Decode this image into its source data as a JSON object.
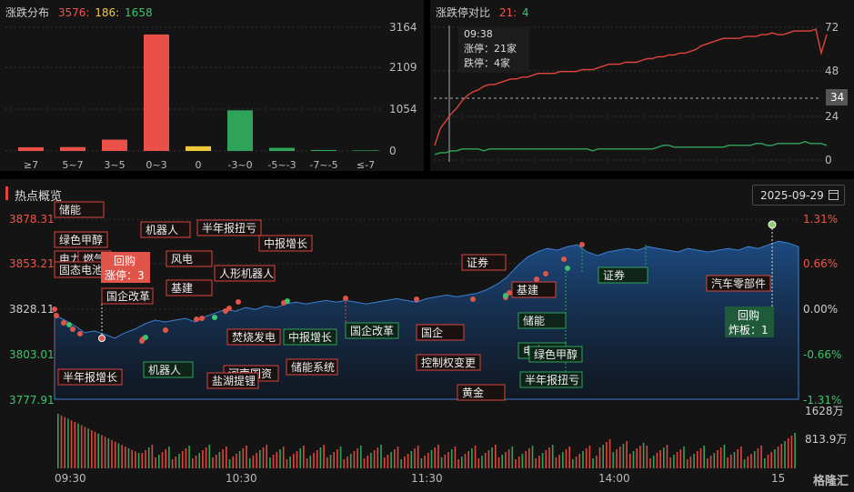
{
  "dist": {
    "title": "涨跌分布",
    "up": "3576:",
    "flat": "186:",
    "down": "1658",
    "y_ticks": [
      "3164",
      "2109",
      "1054",
      "0"
    ],
    "chart_data": {
      "type": "bar",
      "categories": [
        "≥7",
        "5~7",
        "3~5",
        "0~3",
        "0",
        "-3~0",
        "-5~-3",
        "-7~-5",
        "≤-7"
      ],
      "values": [
        95,
        100,
        290,
        2980,
        120,
        1040,
        80,
        25,
        15
      ],
      "colors": [
        "#e95148",
        "#e95148",
        "#e95148",
        "#e95148",
        "#f0c93a",
        "#2fa35a",
        "#2fa35a",
        "#2fa35a",
        "#2fa35a"
      ],
      "ylim": [
        0,
        3164
      ]
    }
  },
  "ratio": {
    "title": "涨跌停对比",
    "up": "21:",
    "down": "4",
    "y_ticks": [
      "72",
      "48",
      "24",
      "0"
    ],
    "current_label": "34",
    "tooltip": {
      "time": "09:38",
      "up": "涨停：21家",
      "down": "跌停：4家"
    },
    "chart_data": {
      "type": "line",
      "ylim": [
        0,
        72
      ],
      "series": [
        {
          "color": "#e0443c",
          "values": [
            8,
            17,
            21,
            25,
            28,
            32,
            35,
            37,
            38,
            40,
            41,
            41,
            42,
            43,
            44,
            44,
            45,
            45,
            46,
            47,
            47,
            47,
            47,
            48,
            48,
            48,
            48,
            49,
            49,
            49,
            50,
            51,
            52,
            52,
            52,
            53,
            53,
            53,
            54,
            55,
            55,
            56,
            56,
            57,
            57,
            58,
            58,
            59,
            60,
            62,
            63,
            64,
            65,
            66,
            66,
            66,
            66,
            67,
            67,
            67,
            68,
            68,
            69,
            68,
            68,
            69,
            70,
            70,
            70,
            70,
            71,
            58,
            68
          ]
        },
        {
          "color": "#2fa35a",
          "values": [
            3,
            4,
            4,
            5,
            5,
            6,
            6,
            6,
            6,
            5,
            6,
            6,
            6,
            6,
            6,
            6,
            6,
            6,
            6,
            6,
            6,
            6,
            6,
            6,
            6,
            6,
            6,
            6,
            6,
            5,
            6,
            6,
            6,
            6,
            6,
            6,
            6,
            6,
            6,
            6,
            6,
            7,
            8,
            8,
            7,
            7,
            7,
            7,
            7,
            7,
            7,
            7,
            7,
            7,
            8,
            8,
            8,
            8,
            8,
            9,
            9,
            8,
            8,
            9,
            9,
            9,
            9,
            9,
            10,
            9,
            9,
            9,
            8
          ]
        }
      ]
    }
  },
  "hot": {
    "title": "热点概览",
    "date": "2025-09-29",
    "y_left": [
      "3878.31",
      "3853.21",
      "3828.11",
      "3803.01",
      "3777.91"
    ],
    "y_right": [
      "1.31%",
      "0.66%",
      "0.00%",
      "-0.66%",
      "-1.31%"
    ],
    "vol_labels": [
      "1628万",
      "813.9万"
    ],
    "x_ticks": [
      "09:30",
      "10:30",
      "11:30",
      "14:00",
      "15"
    ],
    "chart_data": {
      "type": "area",
      "ylim": [
        3777.91,
        3878.31
      ],
      "values": [
        3825,
        3822,
        3819,
        3815,
        3816,
        3814,
        3812,
        3815,
        3817,
        3820,
        3822,
        3821,
        3822,
        3823,
        3821,
        3824,
        3826,
        3828,
        3827,
        3829,
        3828,
        3830,
        3829,
        3831,
        3832,
        3831,
        3832,
        3833,
        3832,
        3833,
        3832,
        3831,
        3832,
        3833,
        3834,
        3833,
        3832,
        3834,
        3835,
        3836,
        3835,
        3836,
        3837,
        3839,
        3842,
        3846,
        3852,
        3857,
        3860,
        3862,
        3861,
        3863,
        3864,
        3860,
        3858,
        3860,
        3861,
        3862,
        3861,
        3863,
        3862,
        3861,
        3860,
        3862,
        3861,
        3860,
        3861,
        3862,
        3861,
        3863,
        3862,
        3864,
        3866,
        3865,
        3863
      ]
    },
    "tags": [
      {
        "t": "储能",
        "k": "r"
      },
      {
        "t": "绿色甲醇",
        "k": "r"
      },
      {
        "t": "电力",
        "k": "r"
      },
      {
        "t": "燃气",
        "k": "r"
      },
      {
        "t": "固态电池",
        "k": "r"
      },
      {
        "t": "国企改革",
        "k": "r"
      },
      {
        "t": "半年报增长",
        "k": "r"
      },
      {
        "t": "机器人",
        "k": "r"
      },
      {
        "t": "风电",
        "k": "r"
      },
      {
        "t": "基建",
        "k": "r"
      },
      {
        "t": "机器人",
        "k": "g"
      },
      {
        "t": "半年报扭亏",
        "k": "r"
      },
      {
        "t": "中报增长",
        "k": "r"
      },
      {
        "t": "人形机器人",
        "k": "r"
      },
      {
        "t": "焚烧发电",
        "k": "r"
      },
      {
        "t": "河南国资",
        "k": "r"
      },
      {
        "t": "盐湖提锂",
        "k": "r"
      },
      {
        "t": "中报增长",
        "k": "g"
      },
      {
        "t": "储能系统",
        "k": "r"
      },
      {
        "t": "国企改革",
        "k": "g"
      },
      {
        "t": "国企",
        "k": "r"
      },
      {
        "t": "控制权变更",
        "k": "r"
      },
      {
        "t": "黄金",
        "k": "r"
      },
      {
        "t": "证券",
        "k": "r"
      },
      {
        "t": "基建",
        "k": "r"
      },
      {
        "t": "储能",
        "k": "g"
      },
      {
        "t": "电力",
        "k": "g"
      },
      {
        "t": "绿色甲醇",
        "k": "g"
      },
      {
        "t": "半年报扭亏",
        "k": "g"
      },
      {
        "t": "证券",
        "k": "g"
      },
      {
        "t": "汽车零部件",
        "k": "r"
      }
    ],
    "callout_up": {
      "title": "回购",
      "sub": "涨停：3"
    },
    "callout_down": {
      "title": "回购",
      "sub": "炸板：1"
    },
    "watermark": "格隆汇"
  }
}
